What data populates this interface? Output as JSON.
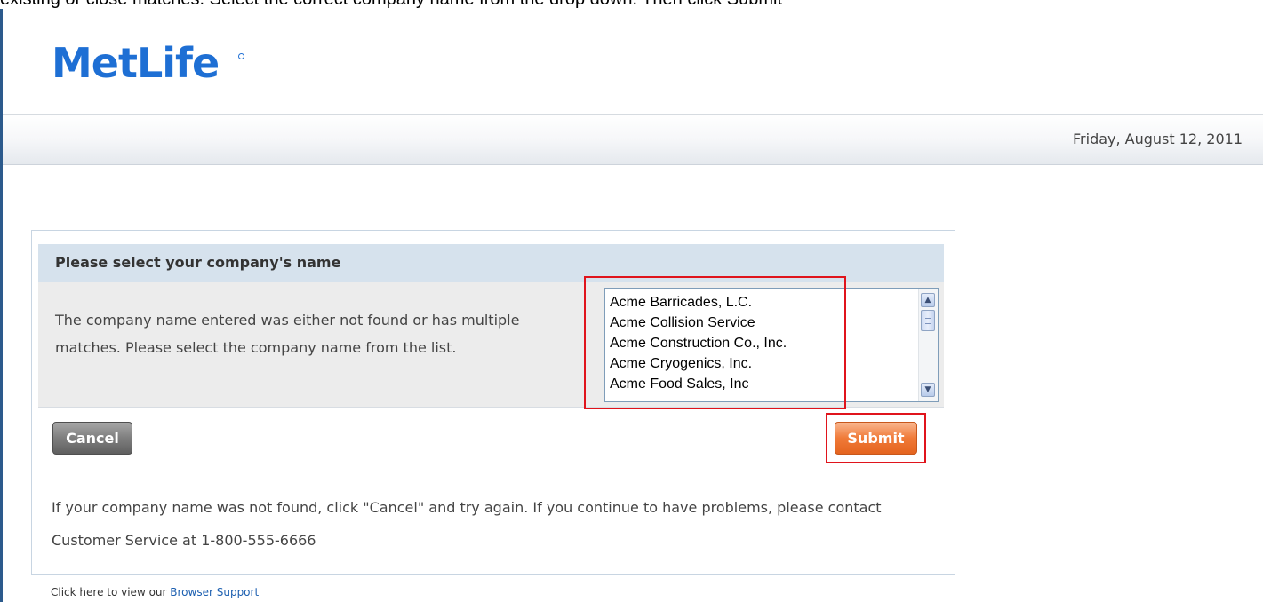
{
  "instruction_fragment": "existing or close matches. Select the correct company name from the drop down. Then click Submit",
  "header": {
    "logo": "MetLife",
    "date": "Friday, August 12, 2011"
  },
  "panel": {
    "title": "Please select your company's name",
    "message": "The company name entered was either not found or has multiple matches. Please select the company name from the list.",
    "company_list": [
      "Acme Barricades, L.C.",
      "Acme Collision Service",
      "Acme Construction Co., Inc.",
      "Acme Cryogenics, Inc.",
      "Acme Food Sales, Inc"
    ],
    "cancel_label": "Cancel",
    "submit_label": "Submit",
    "help_text": "If your company name was not found, click \"Cancel\" and try again. If you continue to have problems, please contact Customer Service at 1-800-555-6666"
  },
  "footer": {
    "prefix": "Click here to view our ",
    "link": "Browser Support"
  },
  "icons": {
    "scroll_up": "scroll-up-arrow-icon",
    "scroll_down": "scroll-down-arrow-icon"
  },
  "colors": {
    "brand_blue": "#1e6fd4",
    "submit_orange": "#f07a38",
    "cancel_gray": "#7e7e7e",
    "highlight_red": "#e0141c",
    "panel_header": "#d6e2ed"
  }
}
